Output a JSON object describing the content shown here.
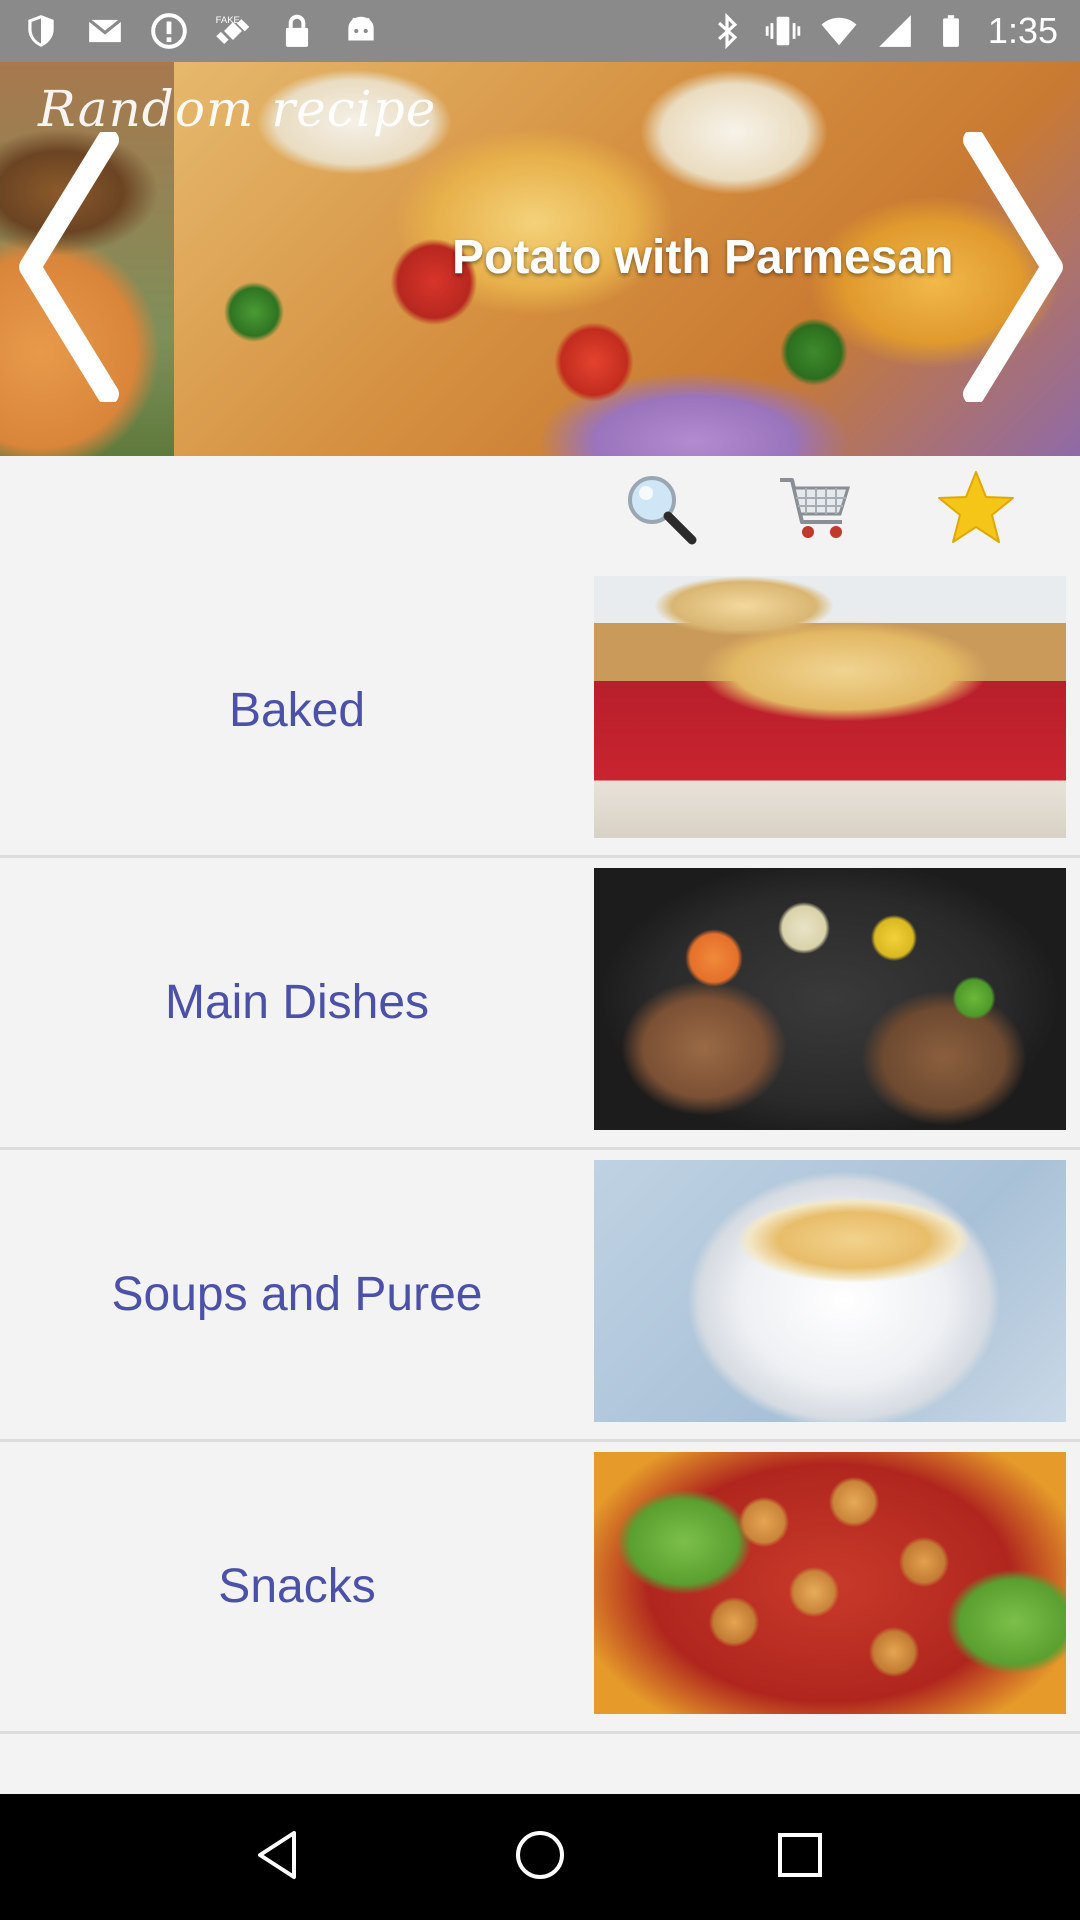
{
  "status_bar": {
    "time": "1:35",
    "left_icons": [
      "shield-icon",
      "mail-icon",
      "alert-circle-icon",
      "fake-gps-icon",
      "lock-icon",
      "android-icon"
    ],
    "right_icons": [
      "bluetooth-icon",
      "vibrate-icon",
      "wifi-icon",
      "signal-icon",
      "battery-icon"
    ],
    "background": "#8a8a8a"
  },
  "banner": {
    "label": "Random recipe",
    "title": "Potato with Parmesan",
    "prev_icon": "chevron-left-icon",
    "next_icon": "chevron-right-icon"
  },
  "toolbar": {
    "search_icon": "search-icon",
    "cart_icon": "cart-icon",
    "favorites_icon": "star-icon",
    "star_color": "#f5c518"
  },
  "categories": [
    {
      "label": "Baked"
    },
    {
      "label": "Main Dishes"
    },
    {
      "label": "Soups and Puree"
    },
    {
      "label": "Snacks"
    }
  ],
  "colors": {
    "category_text": "#4b51a8",
    "background": "#f3f3f3",
    "divider": "#dcdcdc"
  },
  "nav_bar": {
    "back_icon": "back-triangle-icon",
    "home_icon": "home-circle-icon",
    "recents_icon": "recents-square-icon"
  }
}
